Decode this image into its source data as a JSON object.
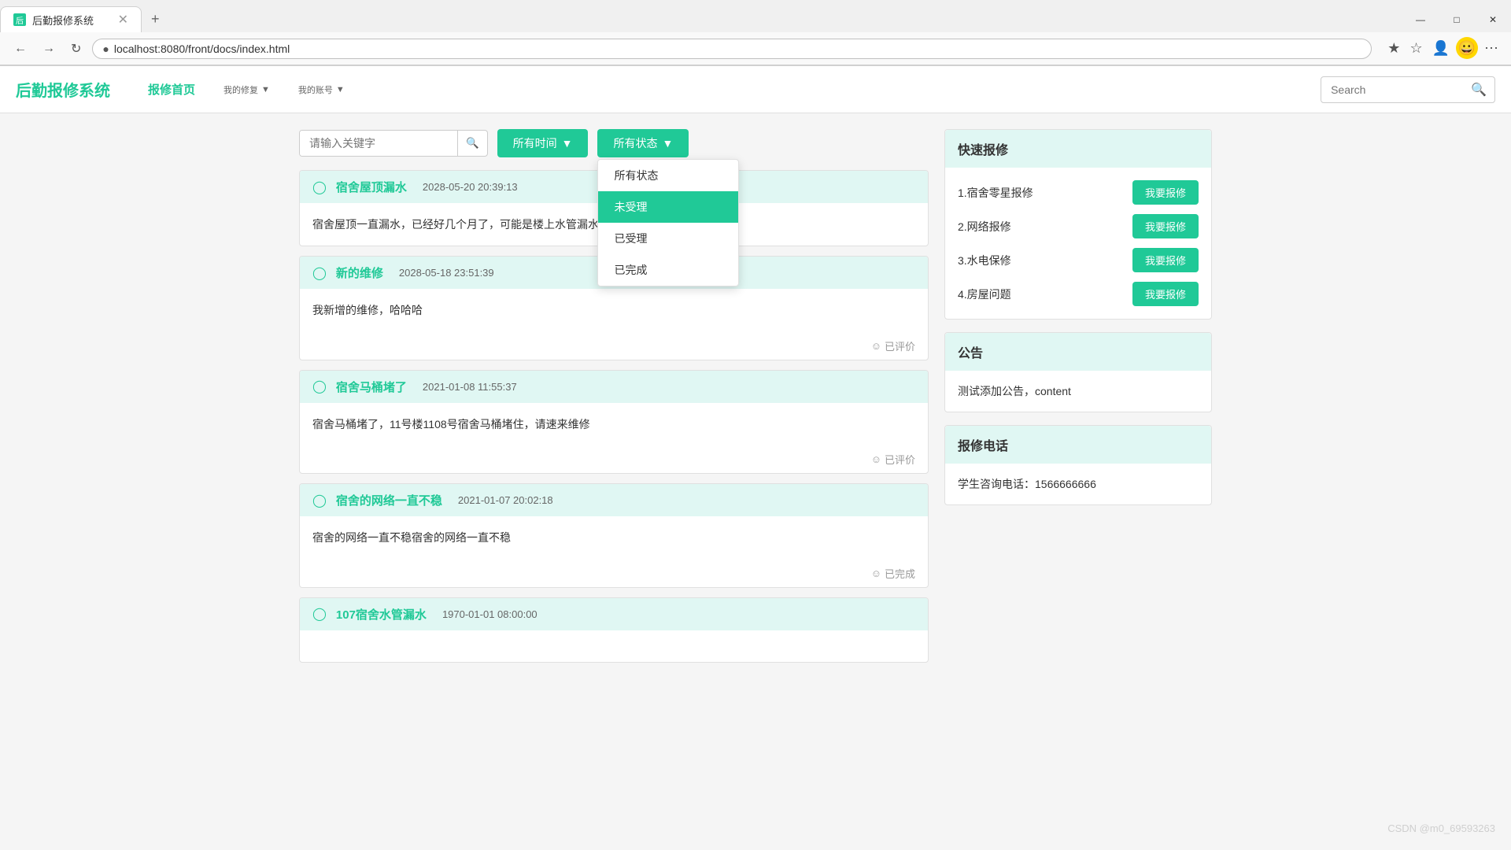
{
  "browser": {
    "tab_title": "后勤报修系统",
    "url": "localhost:8080/front/docs/index.html",
    "new_tab_icon": "+",
    "minimize": "—",
    "maximize": "□",
    "close": "✕"
  },
  "header": {
    "logo": "后勤报修系统",
    "nav": {
      "home": "报修首页",
      "my_repair": "我的修复",
      "my_account": "我的账号"
    },
    "search_placeholder": "Search"
  },
  "filter": {
    "search_placeholder": "请输入关键字",
    "time_filter": "所有时间",
    "status_filter": "所有状态",
    "dropdown_items": [
      "所有状态",
      "未受理",
      "已受理",
      "已完成"
    ],
    "active_status": "未受理"
  },
  "repairs": [
    {
      "id": 1,
      "title": "宿舍屋顶漏水",
      "date": "2028-05-20 20:39:13",
      "content": "宿舍屋顶一直漏水，已经好几个月了，可能是楼上水管漏水，沿着...",
      "status": "",
      "has_rating": false
    },
    {
      "id": 2,
      "title": "新的维修",
      "date": "2028-05-18 23:51:39",
      "content": "我新增的维修，哈哈哈",
      "status": "已评价",
      "has_rating": true
    },
    {
      "id": 3,
      "title": "宿舍马桶堵了",
      "date": "2021-01-08 11:55:37",
      "content": "宿舍马桶堵了，11号楼1108号宿舍马桶堵住，请速来维修",
      "status": "已评价",
      "has_rating": true
    },
    {
      "id": 4,
      "title": "宿舍的网络一直不稳",
      "date": "2021-01-07 20:02:18",
      "content": "宿舍的网络一直不稳宿舍的网络一直不稳",
      "status": "已完成",
      "has_rating": true
    },
    {
      "id": 5,
      "title": "107宿舍水管漏水",
      "date": "1970-01-01 08:00:00",
      "content": "",
      "status": "",
      "has_rating": false
    }
  ],
  "quick_repair": {
    "title": "快速报修",
    "items": [
      {
        "label": "1.宿舍零星报修",
        "btn": "我要报修"
      },
      {
        "label": "2.网络报修",
        "btn": "我要报修"
      },
      {
        "label": "3.水电保修",
        "btn": "我要报修"
      },
      {
        "label": "4.房屋问题",
        "btn": "我要报修"
      }
    ]
  },
  "notice": {
    "title": "公告",
    "content": "测试添加公告，content"
  },
  "phone": {
    "title": "报修电话",
    "content": "学生咨询电话：1566666666"
  },
  "status_icon": "☺",
  "pin_icon": "⊙"
}
